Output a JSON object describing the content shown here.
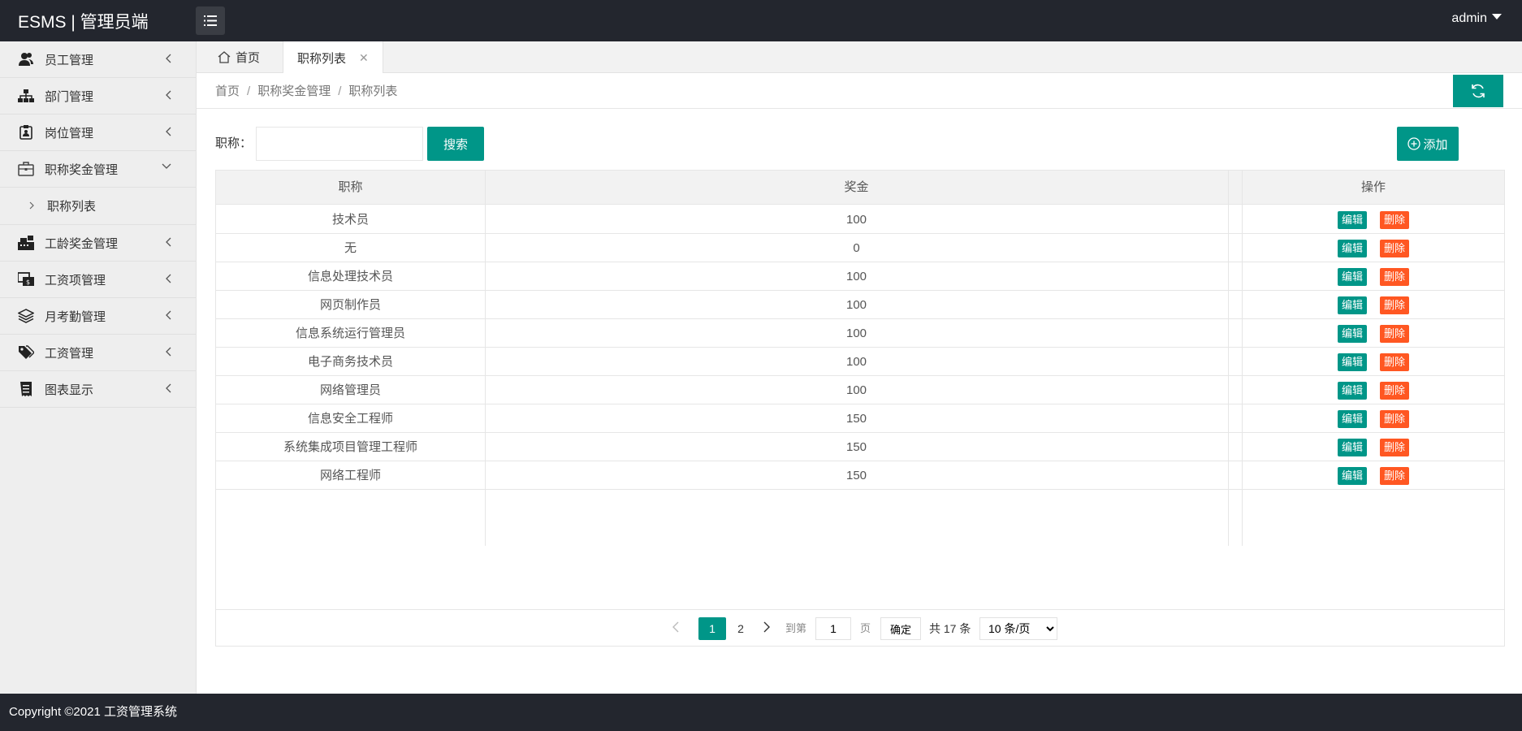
{
  "header": {
    "logo": "ESMS | 管理员端",
    "user": "admin"
  },
  "sidebar": {
    "items": [
      {
        "label": "员工管理",
        "icon": "users-icon"
      },
      {
        "label": "部门管理",
        "icon": "sitemap-icon"
      },
      {
        "label": "岗位管理",
        "icon": "badge-icon"
      },
      {
        "label": "职称奖金管理",
        "icon": "briefcase-icon",
        "expanded": true,
        "sub": [
          {
            "label": "职称列表"
          }
        ]
      },
      {
        "label": "工龄奖金管理",
        "icon": "cash-register-icon"
      },
      {
        "label": "工资项管理",
        "icon": "money-icon"
      },
      {
        "label": "月考勤管理",
        "icon": "layers-icon"
      },
      {
        "label": "工资管理",
        "icon": "tags-icon"
      },
      {
        "label": "图表显示",
        "icon": "receipt-icon"
      }
    ]
  },
  "tabs": {
    "home": "首页",
    "active": "职称列表"
  },
  "breadcrumb": {
    "home": "首页",
    "parent": "职称奖金管理",
    "current": "职称列表",
    "separator": "/"
  },
  "search": {
    "label": "职称：",
    "value": "",
    "button": "搜索"
  },
  "add_button": "添加",
  "table": {
    "headers": [
      "职称",
      "奖金",
      "操作"
    ],
    "rows": [
      {
        "title": "技术员",
        "bonus": "100"
      },
      {
        "title": "无",
        "bonus": "0"
      },
      {
        "title": "信息处理技术员",
        "bonus": "100"
      },
      {
        "title": "网页制作员",
        "bonus": "100"
      },
      {
        "title": "信息系统运行管理员",
        "bonus": "100"
      },
      {
        "title": "电子商务技术员",
        "bonus": "100"
      },
      {
        "title": "网络管理员",
        "bonus": "100"
      },
      {
        "title": "信息安全工程师",
        "bonus": "150"
      },
      {
        "title": "系统集成项目管理工程师",
        "bonus": "150"
      },
      {
        "title": "网络工程师",
        "bonus": "150"
      }
    ],
    "edit_label": "编辑",
    "delete_label": "删除"
  },
  "pagination": {
    "current": "1",
    "next_page": "2",
    "goto_label": "到第",
    "goto_value": "1",
    "page_label": "页",
    "confirm": "确定",
    "total": "共 17 条",
    "page_size": "10 条/页",
    "page_size_options": [
      "10 条/页"
    ]
  },
  "footer": {
    "copyright": "Copyright ©2021 工资管理系统"
  },
  "colors": {
    "primary": "#009688",
    "danger": "#ff5722",
    "header_bg": "#23262e",
    "sidebar_bg": "#eeeeee"
  }
}
